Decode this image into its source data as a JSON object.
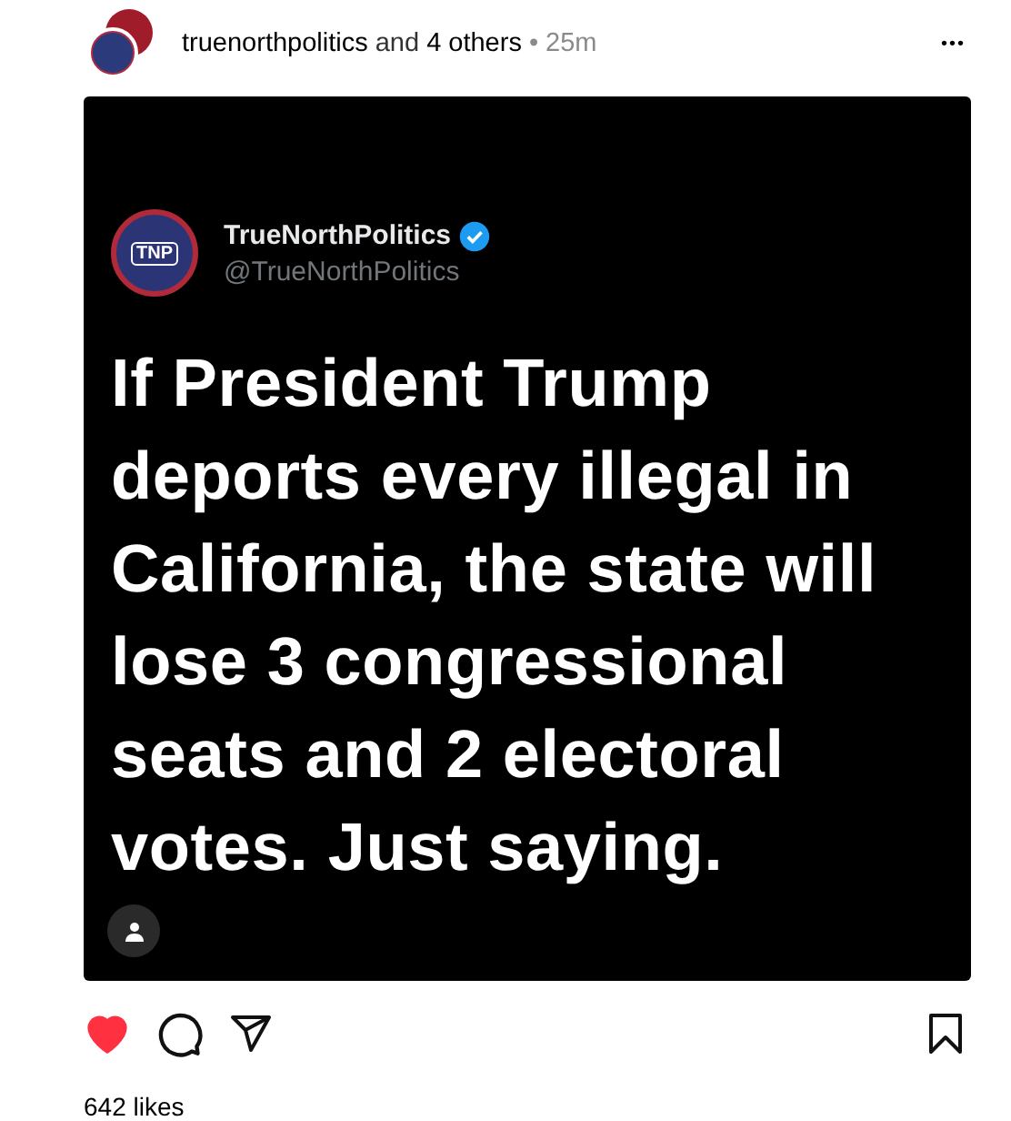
{
  "post": {
    "author": "truenorthpolitics",
    "joiner": "and",
    "others": "4 others",
    "separator": "•",
    "time": "25m",
    "menu": "•••"
  },
  "tweet": {
    "avatar_text": "TNP",
    "name": "TrueNorthPolitics",
    "verified": true,
    "handle": "@TrueNorthPolitics",
    "text": "If President Trump deports every illegal in California, the state will lose 3 congressional seats and 2 electoral votes. Just saying."
  },
  "actions": {
    "liked": true,
    "saved": false
  },
  "likes": "642 likes"
}
